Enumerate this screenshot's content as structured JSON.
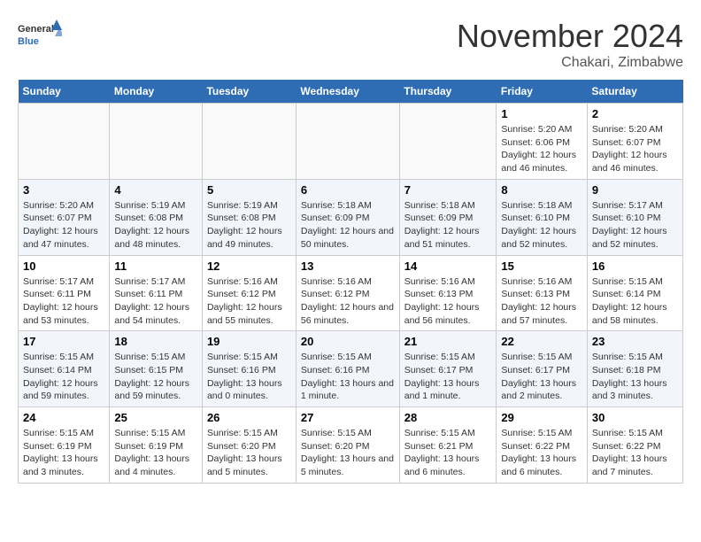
{
  "header": {
    "logo_general": "General",
    "logo_blue": "Blue",
    "title": "November 2024",
    "subtitle": "Chakari, Zimbabwe"
  },
  "calendar": {
    "days_of_week": [
      "Sunday",
      "Monday",
      "Tuesday",
      "Wednesday",
      "Thursday",
      "Friday",
      "Saturday"
    ],
    "weeks": [
      [
        {
          "day": "",
          "info": ""
        },
        {
          "day": "",
          "info": ""
        },
        {
          "day": "",
          "info": ""
        },
        {
          "day": "",
          "info": ""
        },
        {
          "day": "",
          "info": ""
        },
        {
          "day": "1",
          "info": "Sunrise: 5:20 AM\nSunset: 6:06 PM\nDaylight: 12 hours and 46 minutes."
        },
        {
          "day": "2",
          "info": "Sunrise: 5:20 AM\nSunset: 6:07 PM\nDaylight: 12 hours and 46 minutes."
        }
      ],
      [
        {
          "day": "3",
          "info": "Sunrise: 5:20 AM\nSunset: 6:07 PM\nDaylight: 12 hours and 47 minutes."
        },
        {
          "day": "4",
          "info": "Sunrise: 5:19 AM\nSunset: 6:08 PM\nDaylight: 12 hours and 48 minutes."
        },
        {
          "day": "5",
          "info": "Sunrise: 5:19 AM\nSunset: 6:08 PM\nDaylight: 12 hours and 49 minutes."
        },
        {
          "day": "6",
          "info": "Sunrise: 5:18 AM\nSunset: 6:09 PM\nDaylight: 12 hours and 50 minutes."
        },
        {
          "day": "7",
          "info": "Sunrise: 5:18 AM\nSunset: 6:09 PM\nDaylight: 12 hours and 51 minutes."
        },
        {
          "day": "8",
          "info": "Sunrise: 5:18 AM\nSunset: 6:10 PM\nDaylight: 12 hours and 52 minutes."
        },
        {
          "day": "9",
          "info": "Sunrise: 5:17 AM\nSunset: 6:10 PM\nDaylight: 12 hours and 52 minutes."
        }
      ],
      [
        {
          "day": "10",
          "info": "Sunrise: 5:17 AM\nSunset: 6:11 PM\nDaylight: 12 hours and 53 minutes."
        },
        {
          "day": "11",
          "info": "Sunrise: 5:17 AM\nSunset: 6:11 PM\nDaylight: 12 hours and 54 minutes."
        },
        {
          "day": "12",
          "info": "Sunrise: 5:16 AM\nSunset: 6:12 PM\nDaylight: 12 hours and 55 minutes."
        },
        {
          "day": "13",
          "info": "Sunrise: 5:16 AM\nSunset: 6:12 PM\nDaylight: 12 hours and 56 minutes."
        },
        {
          "day": "14",
          "info": "Sunrise: 5:16 AM\nSunset: 6:13 PM\nDaylight: 12 hours and 56 minutes."
        },
        {
          "day": "15",
          "info": "Sunrise: 5:16 AM\nSunset: 6:13 PM\nDaylight: 12 hours and 57 minutes."
        },
        {
          "day": "16",
          "info": "Sunrise: 5:15 AM\nSunset: 6:14 PM\nDaylight: 12 hours and 58 minutes."
        }
      ],
      [
        {
          "day": "17",
          "info": "Sunrise: 5:15 AM\nSunset: 6:14 PM\nDaylight: 12 hours and 59 minutes."
        },
        {
          "day": "18",
          "info": "Sunrise: 5:15 AM\nSunset: 6:15 PM\nDaylight: 12 hours and 59 minutes."
        },
        {
          "day": "19",
          "info": "Sunrise: 5:15 AM\nSunset: 6:16 PM\nDaylight: 13 hours and 0 minutes."
        },
        {
          "day": "20",
          "info": "Sunrise: 5:15 AM\nSunset: 6:16 PM\nDaylight: 13 hours and 1 minute."
        },
        {
          "day": "21",
          "info": "Sunrise: 5:15 AM\nSunset: 6:17 PM\nDaylight: 13 hours and 1 minute."
        },
        {
          "day": "22",
          "info": "Sunrise: 5:15 AM\nSunset: 6:17 PM\nDaylight: 13 hours and 2 minutes."
        },
        {
          "day": "23",
          "info": "Sunrise: 5:15 AM\nSunset: 6:18 PM\nDaylight: 13 hours and 3 minutes."
        }
      ],
      [
        {
          "day": "24",
          "info": "Sunrise: 5:15 AM\nSunset: 6:19 PM\nDaylight: 13 hours and 3 minutes."
        },
        {
          "day": "25",
          "info": "Sunrise: 5:15 AM\nSunset: 6:19 PM\nDaylight: 13 hours and 4 minutes."
        },
        {
          "day": "26",
          "info": "Sunrise: 5:15 AM\nSunset: 6:20 PM\nDaylight: 13 hours and 5 minutes."
        },
        {
          "day": "27",
          "info": "Sunrise: 5:15 AM\nSunset: 6:20 PM\nDaylight: 13 hours and 5 minutes."
        },
        {
          "day": "28",
          "info": "Sunrise: 5:15 AM\nSunset: 6:21 PM\nDaylight: 13 hours and 6 minutes."
        },
        {
          "day": "29",
          "info": "Sunrise: 5:15 AM\nSunset: 6:22 PM\nDaylight: 13 hours and 6 minutes."
        },
        {
          "day": "30",
          "info": "Sunrise: 5:15 AM\nSunset: 6:22 PM\nDaylight: 13 hours and 7 minutes."
        }
      ]
    ]
  }
}
